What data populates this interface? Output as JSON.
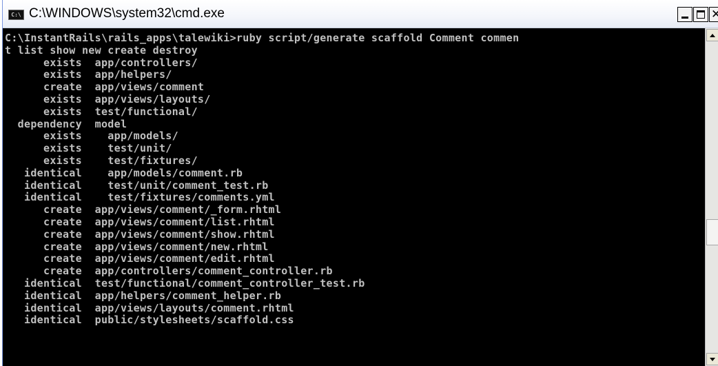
{
  "window": {
    "title": "C:\\WINDOWS\\system32\\cmd.exe",
    "icon_label": "C:\\"
  },
  "titlebar_buttons": {
    "minimize": "minimize-icon",
    "maximize": "maximize-icon",
    "close": "close-icon"
  },
  "console": {
    "lines": [
      "C:\\InstantRails\\rails_apps\\talewiki>ruby script/generate scaffold Comment commen",
      "t list show new create destroy",
      "      exists  app/controllers/",
      "      exists  app/helpers/",
      "      create  app/views/comment",
      "      exists  app/views/layouts/",
      "      exists  test/functional/",
      "  dependency  model",
      "      exists    app/models/",
      "      exists    test/unit/",
      "      exists    test/fixtures/",
      "   identical    app/models/comment.rb",
      "   identical    test/unit/comment_test.rb",
      "   identical    test/fixtures/comments.yml",
      "      create  app/views/comment/_form.rhtml",
      "      create  app/views/comment/list.rhtml",
      "      create  app/views/comment/show.rhtml",
      "      create  app/views/comment/new.rhtml",
      "      create  app/views/comment/edit.rhtml",
      "      create  app/controllers/comment_controller.rb",
      "   identical  test/functional/comment_controller_test.rb",
      "   identical  app/helpers/comment_helper.rb",
      "   identical  app/views/layouts/comment.rhtml",
      "   identical  public/stylesheets/scaffold.css"
    ]
  },
  "colors": {
    "console_bg": "#000000",
    "console_fg": "#c0c0c0",
    "titlebar_bg": "#f4f6fb"
  }
}
